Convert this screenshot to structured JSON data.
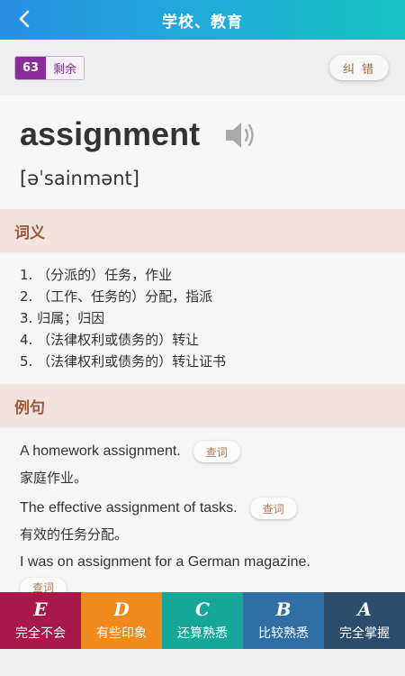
{
  "header": {
    "title": "学校、教育"
  },
  "counter": {
    "count": "63",
    "label": "剩余"
  },
  "report_button": "纠 错",
  "word": {
    "text": "assignment",
    "phonetic": "[əˈsainmənt]"
  },
  "definitions": {
    "heading": "词义",
    "items": [
      "1. （分派的）任务，作业",
      "2. （工作、任务的）分配，指派",
      "3. 归属；归因",
      "4. （法律权利或债务的）转让",
      "5. （法律权利或债务的）转让证书"
    ]
  },
  "examples": {
    "heading": "例句",
    "lookup_label": "查词",
    "items": [
      {
        "en": "A homework assignment.",
        "zh": "家庭作业。"
      },
      {
        "en": "The effective assignment of tasks.",
        "zh": "有效的任务分配。"
      },
      {
        "en": "I was on assignment for a German magazine.",
        "zh": ""
      }
    ]
  },
  "ratings": [
    {
      "letter": "E",
      "label": "完全不会",
      "color": "#a8184a"
    },
    {
      "letter": "D",
      "label": "有些印象",
      "color": "#f08a1c"
    },
    {
      "letter": "C",
      "label": "还算熟悉",
      "color": "#17a79a"
    },
    {
      "letter": "B",
      "label": "比较熟悉",
      "color": "#2f6fa6"
    },
    {
      "letter": "A",
      "label": "完全掌握",
      "color": "#2b4c6b"
    }
  ]
}
